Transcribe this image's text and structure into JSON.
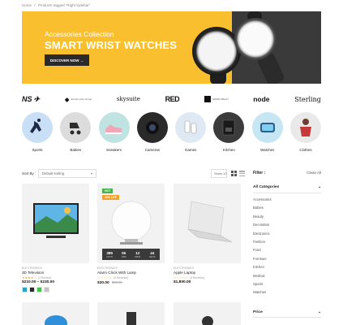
{
  "breadcrumb": {
    "home": "Home",
    "current": "Products tagged “Right Sidebar”"
  },
  "banner": {
    "subtitle": "Accessories Collection",
    "title": "SMART WRIST WATCHES",
    "button_label": "DISCOVER NOW →",
    "accent_color": "#f9bf2f"
  },
  "brands": [
    {
      "name": "NS",
      "icon": "ns-logo"
    },
    {
      "name": "Empire Auto Group",
      "icon": "empire-logo"
    },
    {
      "name": "skysuite",
      "icon": "skysuite-logo"
    },
    {
      "name": "RED",
      "icon": "red-logo"
    },
    {
      "name": "GREEN BEAN",
      "icon": "greenbean-logo"
    },
    {
      "name": "node",
      "icon": "node-logo"
    },
    {
      "name": "Sterling",
      "icon": "sterling-logo"
    }
  ],
  "categories": [
    {
      "label": "Sports",
      "color": "#c9dff5"
    },
    {
      "label": "Babies",
      "color": "#dcdcdc"
    },
    {
      "label": "Sneakers",
      "color": "#bfe3e0"
    },
    {
      "label": "Cameras",
      "color": "#2a2a2a"
    },
    {
      "label": "Games",
      "color": "#dfe9f3"
    },
    {
      "label": "Kitchen",
      "color": "#3b3b3b"
    },
    {
      "label": "Watches",
      "color": "#c7e6f4"
    },
    {
      "label": "Clothes",
      "color": "#e9e9e9"
    }
  ],
  "toolbar": {
    "sort_label": "Sort By :",
    "sort_value": "Default sorting",
    "show_value": "Show 12"
  },
  "products": [
    {
      "category": "Electronics",
      "name": "3D Television",
      "rating": "★★★★☆",
      "reviews": "(1 Review)",
      "price": "$210.00 – $230.00",
      "swatches": [
        "#2aa2c7",
        "#2b2b2b",
        "#47c04b",
        "#c4c4c4"
      ]
    },
    {
      "category": "Electronics",
      "name": "Alarm Clock With Lamp",
      "rating": "☆☆☆☆☆",
      "reviews": "(0 Reviews)",
      "price": "$30.00",
      "old_price": "$50.00",
      "badges": {
        "hot": "HOT",
        "off": "40% OFF"
      },
      "countdown": [
        {
          "n": "385",
          "t": "DAYS"
        },
        {
          "n": "05",
          "t": "HRS"
        },
        {
          "n": "12",
          "t": "MINS"
        },
        {
          "n": "44",
          "t": "SECS"
        }
      ]
    },
    {
      "category": "Electronics",
      "name": "Apple Laptop",
      "rating": "☆☆☆☆☆",
      "reviews": "(0 Reviews)",
      "price": "$1,800.00"
    }
  ],
  "filter": {
    "title": "Filter :",
    "clear": "Clean All",
    "all_categories": "All Categories",
    "items": [
      "Accessories",
      "Babies",
      "Beauty",
      "Decoration",
      "Electronics",
      "Fashion",
      "Food",
      "Furniture",
      "Kitchen",
      "Medical",
      "Sports",
      "Watches"
    ],
    "price_title": "Price"
  }
}
